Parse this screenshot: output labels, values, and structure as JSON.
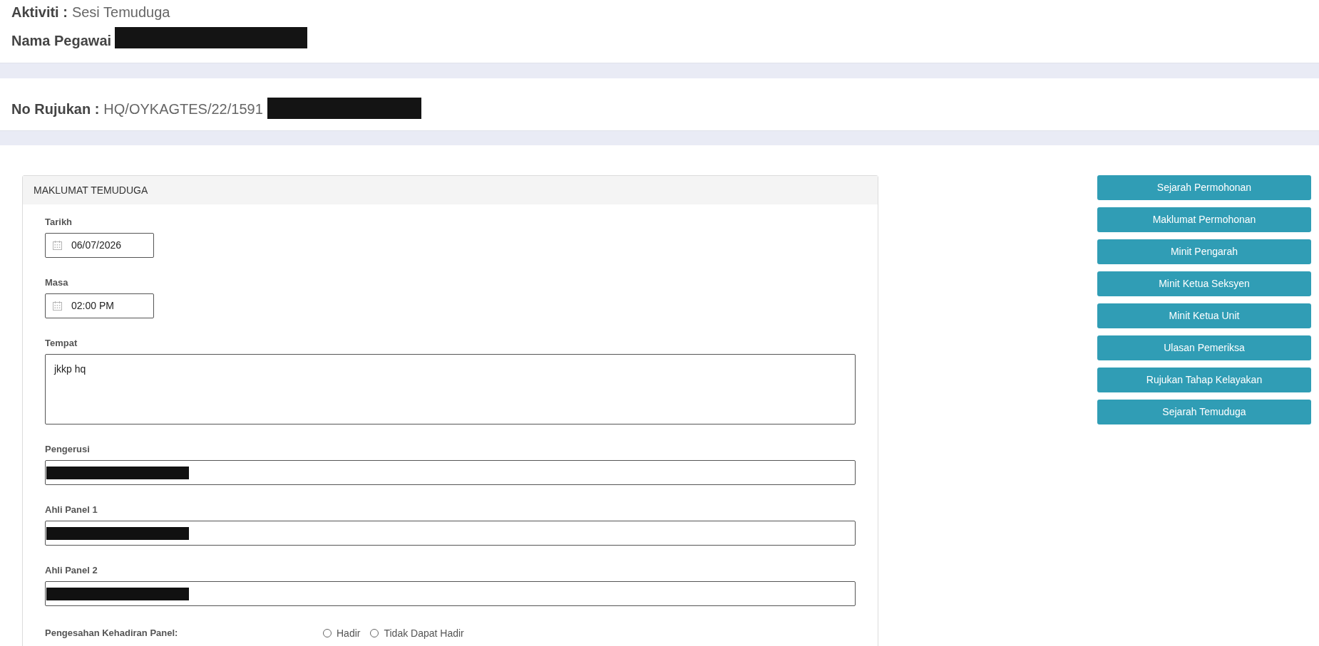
{
  "header": {
    "fields": [
      {
        "label": "Aktiviti :",
        "value": "Sesi Temuduga"
      },
      {
        "label": "Nama Pegawai",
        "redacted": true
      }
    ]
  },
  "reference": {
    "label": "No Rujukan :",
    "value": "HQ/OYKAGTES/22/1591",
    "redacted": true
  },
  "panel": {
    "title": "MAKLUMAT TEMUDUGA",
    "fields": [
      {
        "kind": "date",
        "label": "Tarikh",
        "value": "06/07/2026"
      },
      {
        "kind": "time",
        "label": "Masa",
        "value": "02:00 PM"
      },
      {
        "kind": "textarea",
        "label": "Tempat",
        "value": "jkkp hq"
      },
      {
        "kind": "text",
        "label": "Pengerusi",
        "redacted": true
      },
      {
        "kind": "text",
        "label": "Ahli Panel 1",
        "redacted": true
      },
      {
        "kind": "text",
        "label": "Ahli Panel 2",
        "redacted": true
      }
    ],
    "attendance": {
      "label": "Pengesahan Kehadiran Panel:",
      "options": [
        {
          "label": "Hadir",
          "selected": false
        },
        {
          "label": "Tidak Dapat Hadir",
          "selected": false
        }
      ]
    }
  },
  "actions": [
    "Sejarah Permohonan",
    "Maklumat Permohonan",
    "Minit Pengarah",
    "Minit Ketua Seksyen",
    "Minit Ketua Unit",
    "Ulasan Pemeriksa",
    "Rujukan Tahap Kelayakan",
    "Sejarah Temuduga"
  ]
}
